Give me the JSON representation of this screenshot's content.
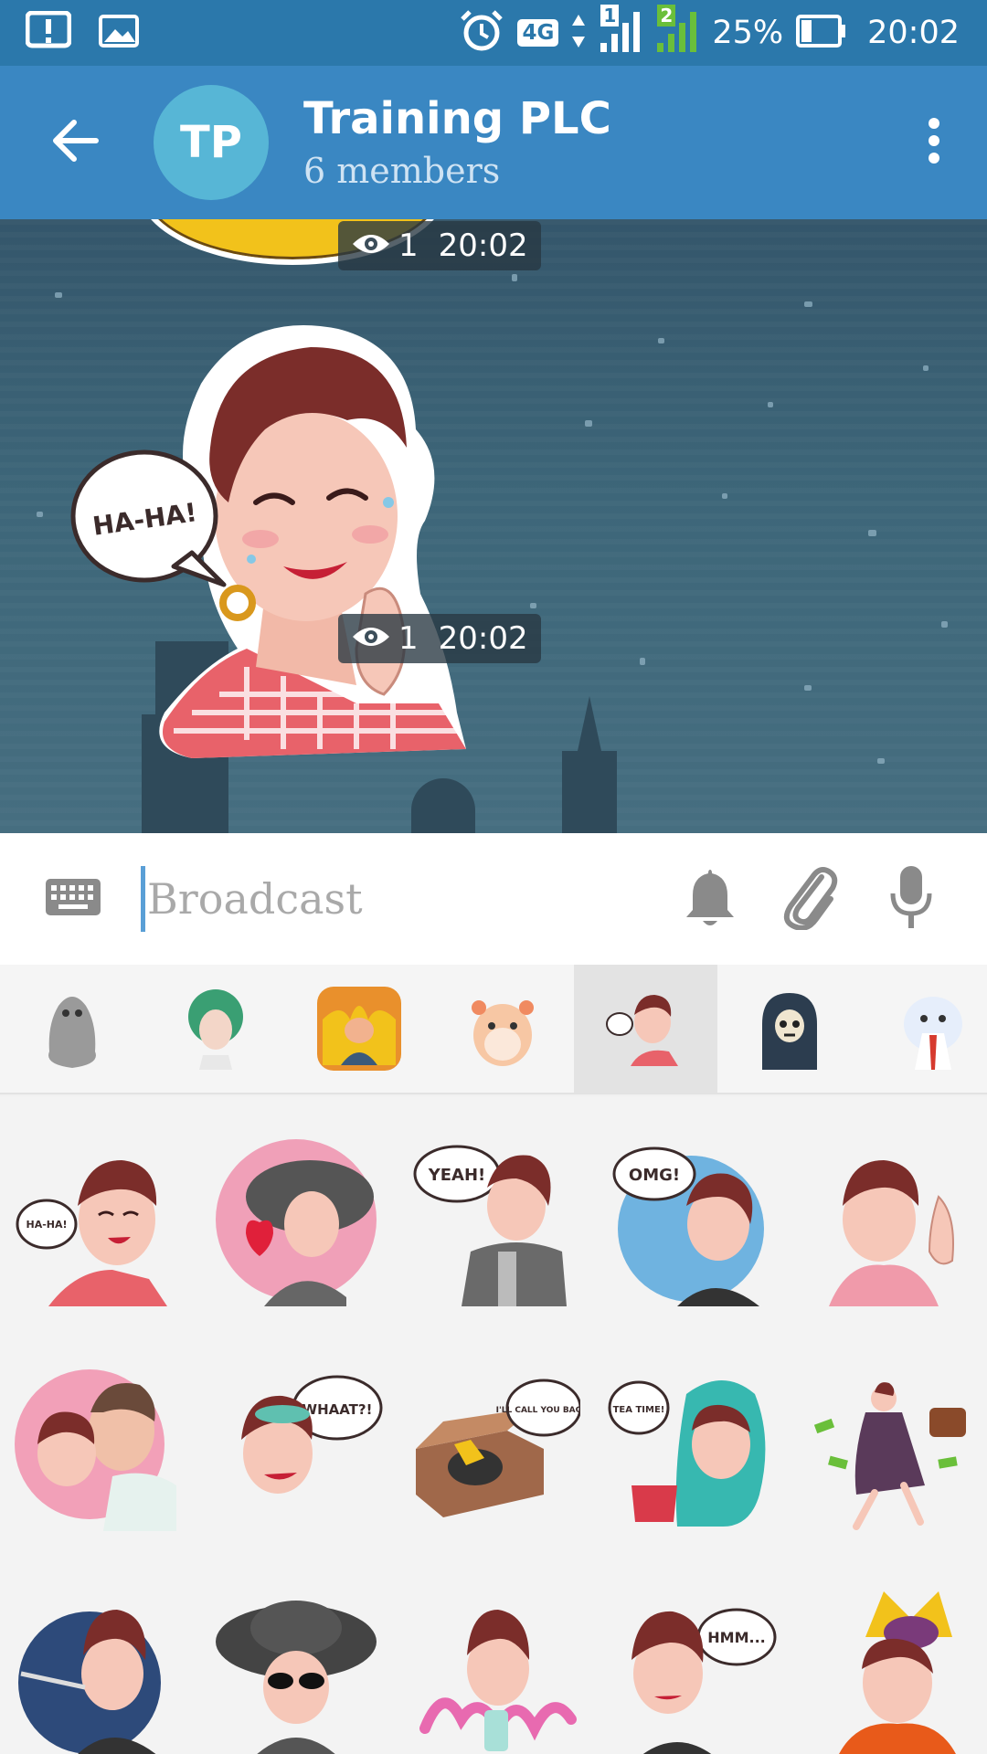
{
  "status_bar": {
    "network": "4G",
    "sim1": "1",
    "sim2": "2",
    "battery": "25%",
    "time": "20:02"
  },
  "header": {
    "avatar_initials": "TP",
    "title": "Training PLC",
    "subtitle": "6 members",
    "back_icon": "arrow-left-icon",
    "menu_icon": "more-vertical-icon"
  },
  "messages": [
    {
      "views": "1",
      "time": "20:02"
    },
    {
      "views": "1",
      "time": "20:02",
      "sticker_text": "HA-HA!"
    }
  ],
  "composer": {
    "placeholder": "Broadcast",
    "icons": [
      "keyboard-icon",
      "bell-icon",
      "paperclip-icon",
      "microphone-icon"
    ]
  },
  "sticker_tabs": [
    {
      "name": "blob"
    },
    {
      "name": "medusa"
    },
    {
      "name": "fire-man"
    },
    {
      "name": "hamster"
    },
    {
      "name": "retro-girl",
      "selected": true
    },
    {
      "name": "skeleton"
    },
    {
      "name": "polar-bear"
    }
  ],
  "stickers": [
    {
      "text": "HA-HA!"
    },
    {
      "text": ""
    },
    {
      "text": "YEAH!"
    },
    {
      "text": "OMG!"
    },
    {
      "text": ""
    },
    {
      "text": ""
    },
    {
      "text": "WHAAT?!"
    },
    {
      "text": "I'LL CALL YOU BACK!"
    },
    {
      "text": "TEA TIME!"
    },
    {
      "text": ""
    },
    {
      "text": ""
    },
    {
      "text": ""
    },
    {
      "text": ""
    },
    {
      "text": "HMM..."
    },
    {
      "text": ""
    }
  ],
  "colors": {
    "status_bar": "#2b78ab",
    "header": "#3a87c2",
    "avatar": "#57b6d6",
    "chat_bg": "#3d6679"
  }
}
